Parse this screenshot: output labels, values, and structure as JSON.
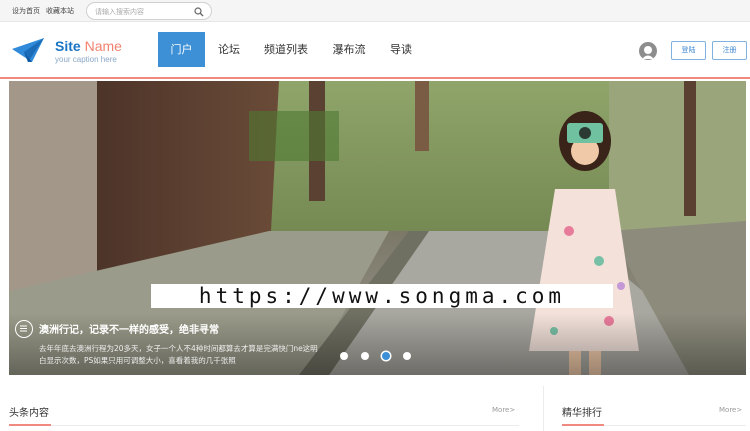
{
  "topbar": {
    "set_home": "设为首页",
    "bookmark": "收藏本站",
    "search_placeholder": "请输入搜索内容"
  },
  "logo": {
    "name_main": "Site",
    "name_accent": "Name",
    "caption": "your caption here"
  },
  "nav": {
    "items": [
      "门户",
      "论坛",
      "频道列表",
      "瀑布流",
      "导读"
    ],
    "active": "门户"
  },
  "user": {
    "login": "登陆",
    "register": "注册"
  },
  "banner": {
    "watermark": "https://www.songma.com",
    "title": "澳洲行记，记录不一样的感受，绝非寻常",
    "desc": "去年年底去澳洲行程为20多天，女子一个人不4种时间都算去才算是完满快门ne这明白显示次数，PS如果只用可调整大小，喜看着我的几千张照",
    "slide_count": 4,
    "active_slide": 3
  },
  "sections": {
    "headline": {
      "title": "头条内容",
      "more": "More>"
    },
    "ranking": {
      "title": "精华排行",
      "more": "More>"
    }
  },
  "colors": {
    "brand_blue": "#3d8fd6",
    "accent_red": "#f08a80",
    "logo_orange": "#f1836f"
  }
}
